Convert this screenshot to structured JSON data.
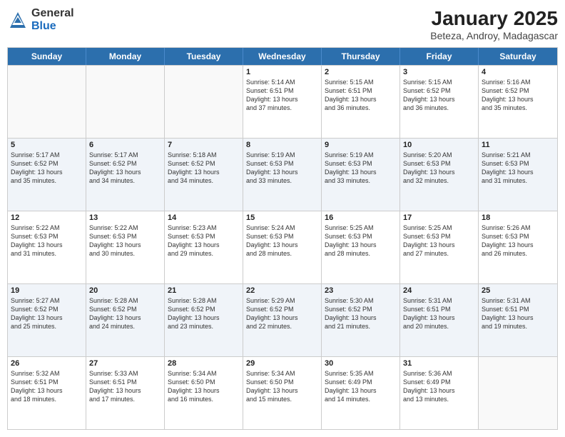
{
  "header": {
    "title": "January 2025",
    "location": "Beteza, Androy, Madagascar",
    "logo_general": "General",
    "logo_blue": "Blue"
  },
  "days_of_week": [
    "Sunday",
    "Monday",
    "Tuesday",
    "Wednesday",
    "Thursday",
    "Friday",
    "Saturday"
  ],
  "weeks": [
    [
      {
        "day": "",
        "info": ""
      },
      {
        "day": "",
        "info": ""
      },
      {
        "day": "",
        "info": ""
      },
      {
        "day": "1",
        "info": "Sunrise: 5:14 AM\nSunset: 6:51 PM\nDaylight: 13 hours\nand 37 minutes."
      },
      {
        "day": "2",
        "info": "Sunrise: 5:15 AM\nSunset: 6:51 PM\nDaylight: 13 hours\nand 36 minutes."
      },
      {
        "day": "3",
        "info": "Sunrise: 5:15 AM\nSunset: 6:52 PM\nDaylight: 13 hours\nand 36 minutes."
      },
      {
        "day": "4",
        "info": "Sunrise: 5:16 AM\nSunset: 6:52 PM\nDaylight: 13 hours\nand 35 minutes."
      }
    ],
    [
      {
        "day": "5",
        "info": "Sunrise: 5:17 AM\nSunset: 6:52 PM\nDaylight: 13 hours\nand 35 minutes."
      },
      {
        "day": "6",
        "info": "Sunrise: 5:17 AM\nSunset: 6:52 PM\nDaylight: 13 hours\nand 34 minutes."
      },
      {
        "day": "7",
        "info": "Sunrise: 5:18 AM\nSunset: 6:52 PM\nDaylight: 13 hours\nand 34 minutes."
      },
      {
        "day": "8",
        "info": "Sunrise: 5:19 AM\nSunset: 6:53 PM\nDaylight: 13 hours\nand 33 minutes."
      },
      {
        "day": "9",
        "info": "Sunrise: 5:19 AM\nSunset: 6:53 PM\nDaylight: 13 hours\nand 33 minutes."
      },
      {
        "day": "10",
        "info": "Sunrise: 5:20 AM\nSunset: 6:53 PM\nDaylight: 13 hours\nand 32 minutes."
      },
      {
        "day": "11",
        "info": "Sunrise: 5:21 AM\nSunset: 6:53 PM\nDaylight: 13 hours\nand 31 minutes."
      }
    ],
    [
      {
        "day": "12",
        "info": "Sunrise: 5:22 AM\nSunset: 6:53 PM\nDaylight: 13 hours\nand 31 minutes."
      },
      {
        "day": "13",
        "info": "Sunrise: 5:22 AM\nSunset: 6:53 PM\nDaylight: 13 hours\nand 30 minutes."
      },
      {
        "day": "14",
        "info": "Sunrise: 5:23 AM\nSunset: 6:53 PM\nDaylight: 13 hours\nand 29 minutes."
      },
      {
        "day": "15",
        "info": "Sunrise: 5:24 AM\nSunset: 6:53 PM\nDaylight: 13 hours\nand 28 minutes."
      },
      {
        "day": "16",
        "info": "Sunrise: 5:25 AM\nSunset: 6:53 PM\nDaylight: 13 hours\nand 28 minutes."
      },
      {
        "day": "17",
        "info": "Sunrise: 5:25 AM\nSunset: 6:53 PM\nDaylight: 13 hours\nand 27 minutes."
      },
      {
        "day": "18",
        "info": "Sunrise: 5:26 AM\nSunset: 6:53 PM\nDaylight: 13 hours\nand 26 minutes."
      }
    ],
    [
      {
        "day": "19",
        "info": "Sunrise: 5:27 AM\nSunset: 6:52 PM\nDaylight: 13 hours\nand 25 minutes."
      },
      {
        "day": "20",
        "info": "Sunrise: 5:28 AM\nSunset: 6:52 PM\nDaylight: 13 hours\nand 24 minutes."
      },
      {
        "day": "21",
        "info": "Sunrise: 5:28 AM\nSunset: 6:52 PM\nDaylight: 13 hours\nand 23 minutes."
      },
      {
        "day": "22",
        "info": "Sunrise: 5:29 AM\nSunset: 6:52 PM\nDaylight: 13 hours\nand 22 minutes."
      },
      {
        "day": "23",
        "info": "Sunrise: 5:30 AM\nSunset: 6:52 PM\nDaylight: 13 hours\nand 21 minutes."
      },
      {
        "day": "24",
        "info": "Sunrise: 5:31 AM\nSunset: 6:51 PM\nDaylight: 13 hours\nand 20 minutes."
      },
      {
        "day": "25",
        "info": "Sunrise: 5:31 AM\nSunset: 6:51 PM\nDaylight: 13 hours\nand 19 minutes."
      }
    ],
    [
      {
        "day": "26",
        "info": "Sunrise: 5:32 AM\nSunset: 6:51 PM\nDaylight: 13 hours\nand 18 minutes."
      },
      {
        "day": "27",
        "info": "Sunrise: 5:33 AM\nSunset: 6:51 PM\nDaylight: 13 hours\nand 17 minutes."
      },
      {
        "day": "28",
        "info": "Sunrise: 5:34 AM\nSunset: 6:50 PM\nDaylight: 13 hours\nand 16 minutes."
      },
      {
        "day": "29",
        "info": "Sunrise: 5:34 AM\nSunset: 6:50 PM\nDaylight: 13 hours\nand 15 minutes."
      },
      {
        "day": "30",
        "info": "Sunrise: 5:35 AM\nSunset: 6:49 PM\nDaylight: 13 hours\nand 14 minutes."
      },
      {
        "day": "31",
        "info": "Sunrise: 5:36 AM\nSunset: 6:49 PM\nDaylight: 13 hours\nand 13 minutes."
      },
      {
        "day": "",
        "info": ""
      }
    ]
  ]
}
